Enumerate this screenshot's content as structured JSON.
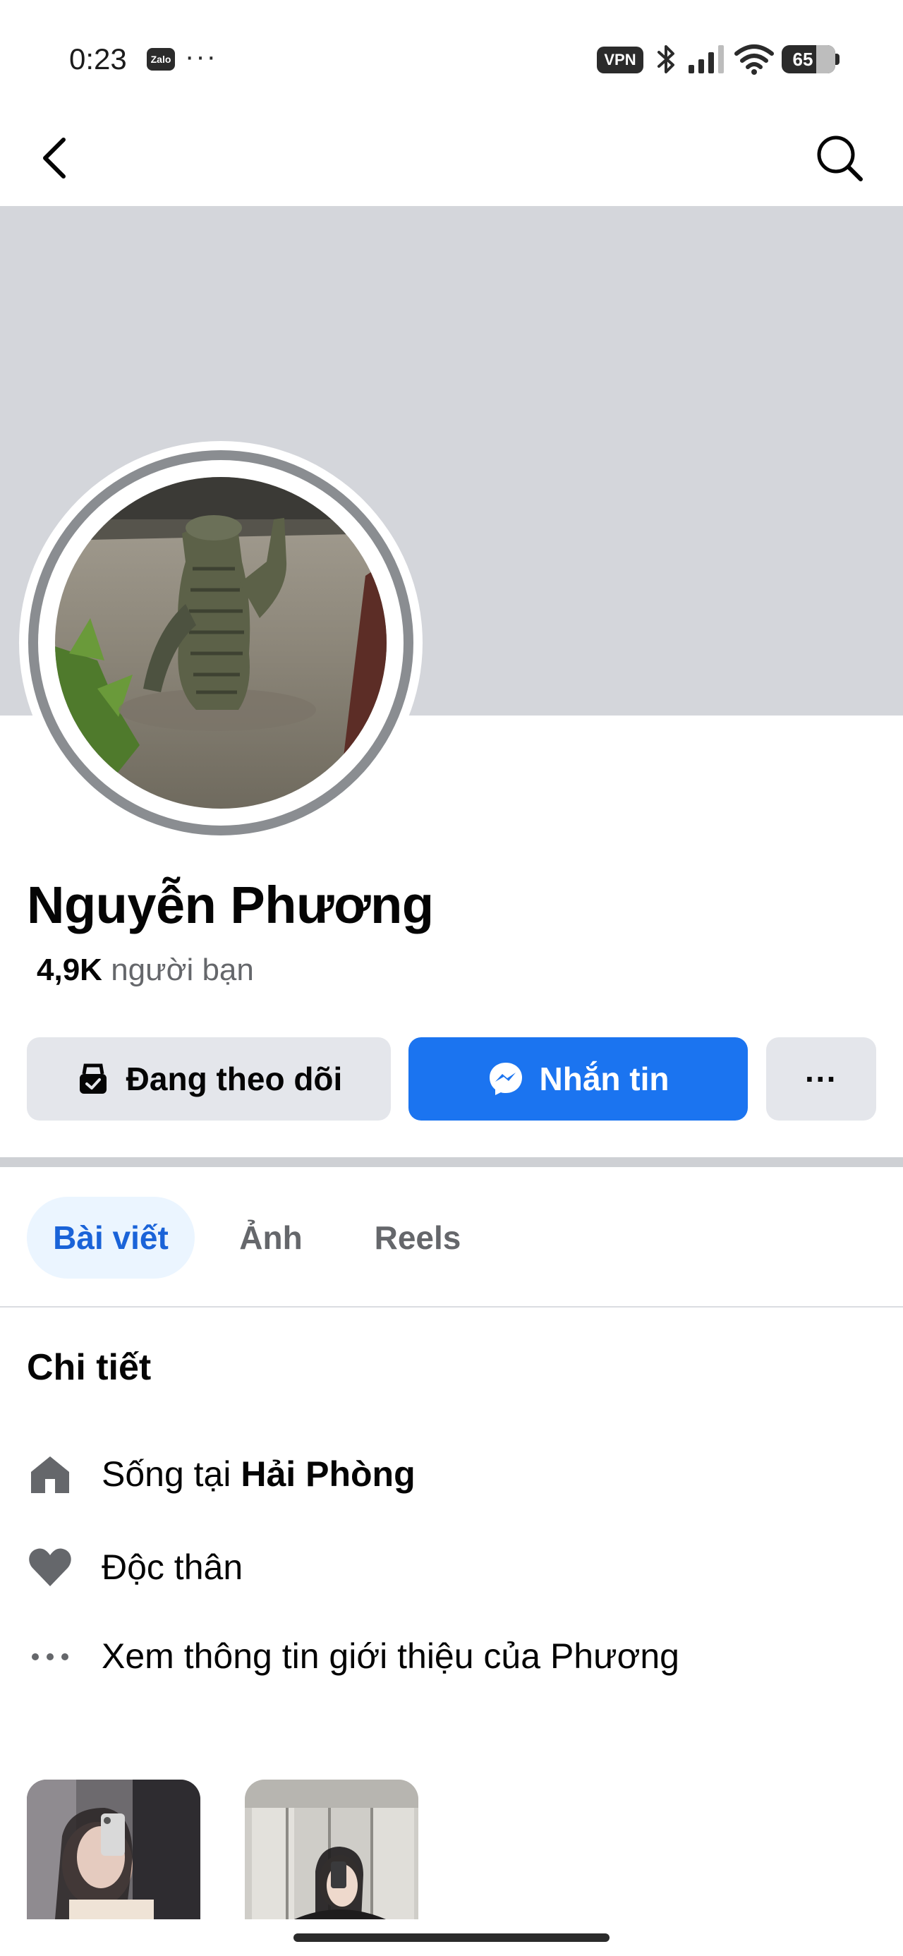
{
  "status_bar": {
    "time": "0:23",
    "zalo_label": "Zalo",
    "more_indicator": "···",
    "vpn_label": "VPN",
    "battery_percent": "65",
    "battery_level": 0.65
  },
  "profile": {
    "name": "Nguyễn Phương",
    "friends_count": "4,9K",
    "friends_label": "người bạn"
  },
  "actions": {
    "following_label": "Đang theo dõi",
    "message_label": "Nhắn tin",
    "more_label": "···"
  },
  "tabs": [
    {
      "label": "Bài viết",
      "active": true
    },
    {
      "label": "Ảnh",
      "active": false
    },
    {
      "label": "Reels",
      "active": false
    }
  ],
  "details": {
    "title": "Chi tiết",
    "lives_prefix": "Sống tại",
    "lives_city": "Hải Phòng",
    "relationship": "Độc thân",
    "see_about": "Xem thông tin giới thiệu của Phương"
  },
  "icons": {
    "back": "back-arrow-icon",
    "search": "search-icon",
    "home": "home-icon",
    "heart": "heart-icon",
    "more": "more-dots-icon",
    "messenger": "messenger-icon",
    "following": "following-icon"
  },
  "colors": {
    "accent": "#1b74f0",
    "tab_active_bg": "#ebf5ff",
    "tab_active_text": "#1a63d8",
    "cover": "#d4d6db",
    "button_gray": "#e4e6eb"
  }
}
